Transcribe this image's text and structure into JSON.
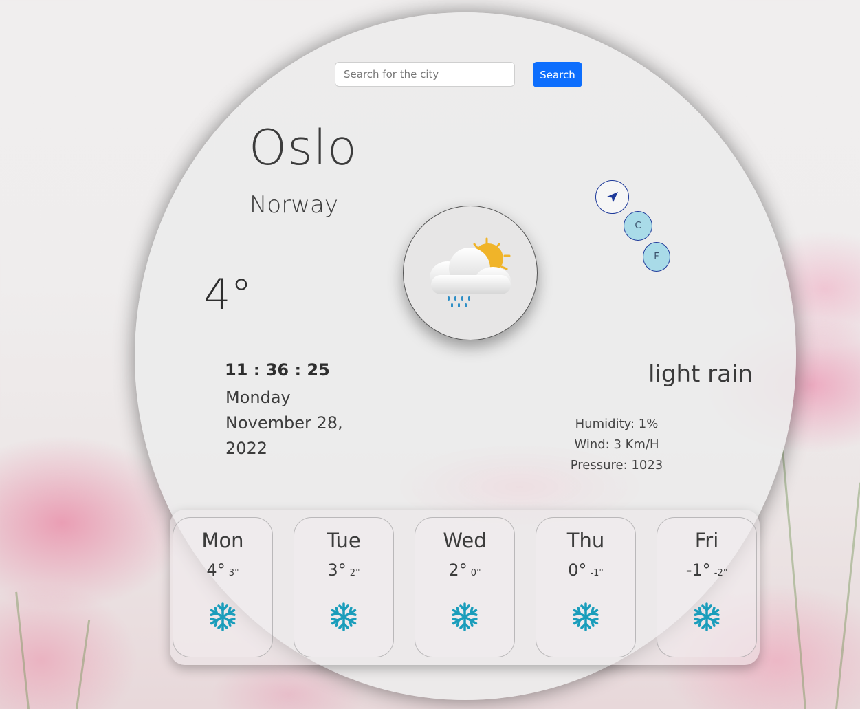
{
  "search": {
    "placeholder": "Search for the city",
    "button_label": "Search"
  },
  "location": {
    "city": "Oslo",
    "country": "Norway"
  },
  "current": {
    "temperature": "4°",
    "time": "11 : 36 : 25",
    "weekday": "Monday",
    "date_line1": "November 28,",
    "date_line2": "2022",
    "description": "light rain",
    "humidity": "Humidity: 1%",
    "wind": "Wind: 3 Km/H",
    "pressure": "Pressure: 1023",
    "icon": "sun-behind-rain-cloud-icon"
  },
  "controls": {
    "location_icon": "navigation-arrow-icon",
    "celsius_label": "C",
    "fahrenheit_label": "F"
  },
  "forecast": [
    {
      "day": "Mon",
      "max": "4°",
      "min": "3°",
      "icon": "snowflake-icon"
    },
    {
      "day": "Tue",
      "max": "3°",
      "min": "2°",
      "icon": "snowflake-icon"
    },
    {
      "day": "Wed",
      "max": "2°",
      "min": "0°",
      "icon": "snowflake-icon"
    },
    {
      "day": "Thu",
      "max": "0°",
      "min": "-1°",
      "icon": "snowflake-icon"
    },
    {
      "day": "Fri",
      "max": "-1°",
      "min": "-2°",
      "icon": "snowflake-icon"
    }
  ],
  "colors": {
    "search_button": "#0d6efd",
    "unit_button_fill": "#a9dbe8",
    "unit_button_border": "#1e3a9a",
    "snowflake": "#1a9dbb",
    "sun": "#f0b429",
    "rain": "#2f8fc6"
  }
}
